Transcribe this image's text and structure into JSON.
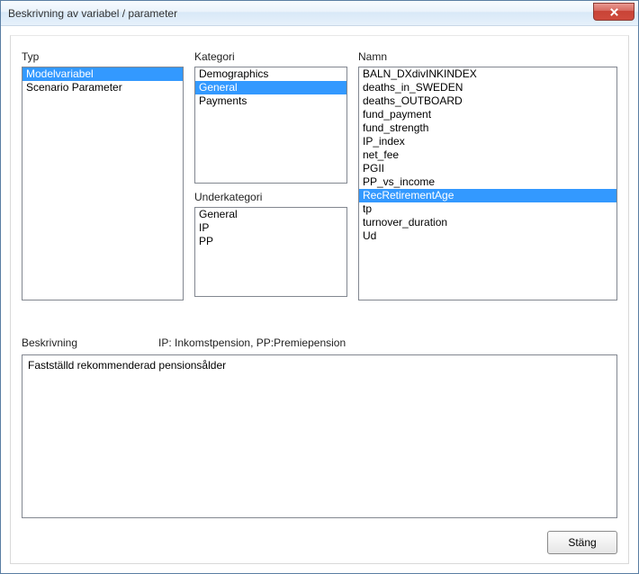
{
  "window": {
    "title": "Beskrivning av variabel / parameter"
  },
  "labels": {
    "typ": "Typ",
    "kategori": "Kategori",
    "underkategori": "Underkategori",
    "namn": "Namn",
    "beskrivning": "Beskrivning",
    "desc_hint": "IP: Inkomstpension, PP:Premiepension",
    "close_button": "Stäng"
  },
  "typ": {
    "items": [
      "Modelvariabel",
      "Scenario Parameter"
    ],
    "selected_index": 0
  },
  "kategori": {
    "items": [
      "Demographics",
      "General",
      "Payments"
    ],
    "selected_index": 1
  },
  "underkategori": {
    "items": [
      "General",
      "IP",
      "PP"
    ],
    "selected_index": -1
  },
  "namn": {
    "items": [
      "BALN_DXdivINKINDEX",
      "deaths_in_SWEDEN",
      "deaths_OUTBOARD",
      "fund_payment",
      "fund_strength",
      "IP_index",
      "net_fee",
      "PGII",
      "PP_vs_income",
      "RecRetirementAge",
      "tp",
      "turnover_duration",
      "Ud"
    ],
    "selected_index": 9
  },
  "description": "Fastställd rekommenderad pensionsålder"
}
